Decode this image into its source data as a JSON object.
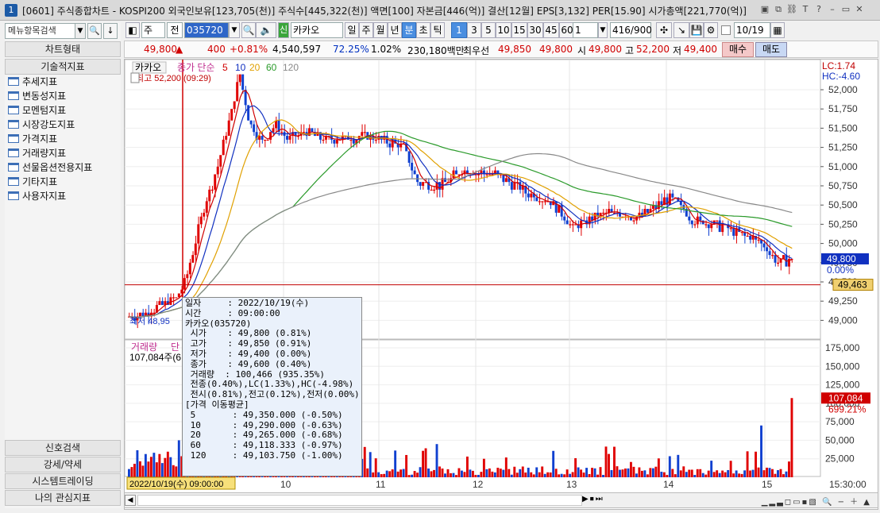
{
  "titlebar": {
    "num": "1",
    "title": "[0601] 주식종합차트 - KOSPI200 외국인보유[123,705(천)] 주식수[445,322(천)] 액면[100] 자본금[446(억)] 결산[12월] EPS[3,132] PER[15.90] 시가총액[221,770(억)]",
    "icons": [
      "layout-icon",
      "copy-window-icon",
      "link-icon",
      "font-icon",
      "help-icon",
      "minimize-icon",
      "maximize-icon",
      "close-icon"
    ],
    "glyphs": [
      "▣",
      "⧉",
      "⛓",
      "T",
      "?",
      "–",
      "▭",
      "✕"
    ]
  },
  "left": {
    "search_placeholder": "메뉴항목검색",
    "tabs": [
      "차트형태",
      "기술적지표"
    ],
    "items": [
      "추세지표",
      "변동성지표",
      "모멘텀지표",
      "시장강도지표",
      "가격지표",
      "거래량지표",
      "선물옵션전용지표",
      "기타지표",
      "사용자지표"
    ],
    "bottom": [
      "신호검색",
      "강세/약세",
      "시스템트레이딩",
      "나의 관심지표"
    ]
  },
  "toolbar": {
    "mode": "주",
    "prev": "전",
    "code": "035720",
    "name": "카카오",
    "periods": [
      "일",
      "주",
      "월",
      "년",
      "분",
      "초",
      "틱"
    ],
    "selected_period": "분",
    "intervals": [
      "1",
      "3",
      "5",
      "10",
      "15",
      "30",
      "45",
      "60"
    ],
    "selected_interval": "1",
    "unit": "1",
    "count": "416/900",
    "date": "10/19",
    "shin": "신"
  },
  "quote": {
    "price": "49,800",
    "arrow": "▲",
    "change": "400",
    "rate": "+0.81%",
    "volume": "4,540,597",
    "ratio1": "72.25%",
    "ratio2": "1.02%",
    "amount": "230,180백만",
    "best_label": "최우선",
    "best_ask": "49,850",
    "best_bid": "49,800",
    "open_label": "시",
    "open": "49,800",
    "high_label": "고",
    "high": "52,200",
    "low_label": "저",
    "low": "49,400",
    "buy": "매수",
    "sell": "매도"
  },
  "chart": {
    "stock_tag": "카카오",
    "ma_title": "종가 단순",
    "ma_periods": [
      "5",
      "10",
      "20",
      "60",
      "120"
    ],
    "ma_colors": [
      "#d00000",
      "#1030c0",
      "#e0a000",
      "#2a9a2a",
      "#888888"
    ],
    "high_mark": "최고 52,200 (09:29)",
    "low_mark": "최저 48,95",
    "lc": "LC:1.74",
    "hc": "HC:-4.60",
    "price_ticks": [
      "52,000",
      "51,750",
      "51,500",
      "51,250",
      "51,000",
      "50,750",
      "50,500",
      "50,250",
      "50,000",
      "49,750",
      "49,500",
      "49,250",
      "49,000"
    ],
    "cur_price_label": "49,800",
    "cur_pct_label": "0.00%",
    "ref_line_label": "49,463",
    "vol_title": "거래량",
    "vol_sub": "단",
    "vol_value": "107,084주(6",
    "vol_ticks": [
      "175,000",
      "150,000",
      "125,000",
      "100,000",
      "75,000",
      "50,000",
      "25,000"
    ],
    "vol_cur_label": "107,084",
    "vol_pct_label": "699.21%",
    "x_ticks": [
      "10",
      "11",
      "12",
      "13",
      "14",
      "15"
    ],
    "time_label": "15:30:00",
    "cursor_label": "2022/10/19(수) 09:00:00"
  },
  "chart_data": {
    "type": "candlestick",
    "title": "카카오",
    "x_labels": [
      "10",
      "11",
      "12",
      "13",
      "14",
      "15"
    ],
    "ylim": [
      48900,
      52300
    ],
    "moving_averages": [
      "5",
      "10",
      "20",
      "60",
      "120"
    ],
    "high": {
      "value": 52200,
      "time": "09:29"
    },
    "last": 49800,
    "reference": 49463,
    "volume_ylim": [
      0,
      180000
    ],
    "last_volume": 107084
  },
  "tooltip": {
    "lines": [
      "일자     : 2022/10/19(수)",
      "시간     : 09:00:00",
      "카카오(035720)",
      " 시가    : 49,800 (0.81%)",
      " 고가    : 49,850 (0.91%)",
      " 저가    : 49,400 (0.00%)",
      " 종가    : 49,600 (0.40%)",
      " 거래량  : 100,466 (935.35%)",
      " 전종(0.40%),LC(1.33%),HC(-4.98%)",
      " 전시(0.81%),전고(0.12%),전저(0.00%)",
      "[가격 이동평균]",
      " 5       : 49,350.000 (-0.50%)",
      " 10      : 49,290.000 (-0.63%)",
      " 20      : 49,265.000 (-0.68%)",
      " 60      : 49,118.333 (-0.97%)",
      " 120     : 49,103.750 (-1.00%)"
    ]
  }
}
